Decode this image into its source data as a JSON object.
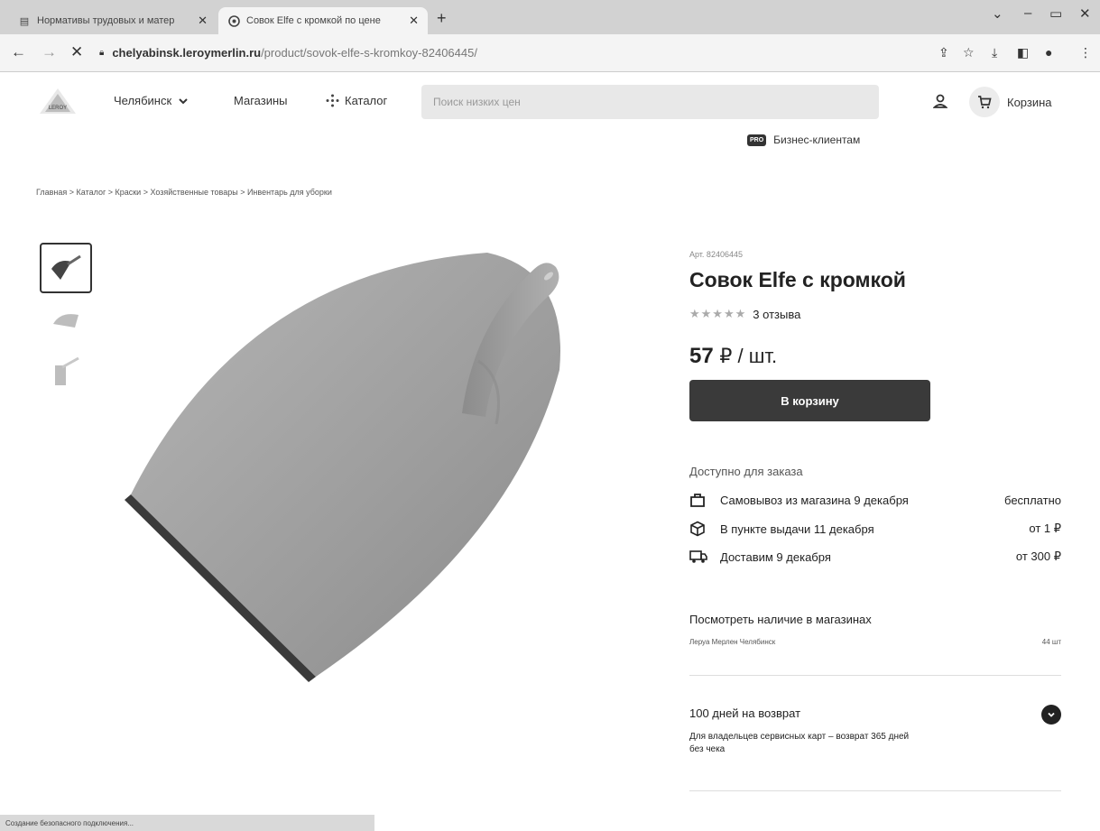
{
  "browser": {
    "tabs": [
      {
        "title": "Нормативы трудовых и матер",
        "active": false
      },
      {
        "title": "Совок Elfe с кромкой по цене",
        "active": true
      }
    ],
    "url_host": "chelyabinsk.leroymerlin.ru",
    "url_path": "/product/sovok-elfe-s-kromkoy-82406445/",
    "status_text": "Создание безопасного подключения..."
  },
  "header": {
    "logo_text": "LEROY MERLIN",
    "city": "Челябинск",
    "stores": "Магазины",
    "catalog": "Каталог",
    "search_placeholder": "Поиск низких цен",
    "cart": "Корзина",
    "business": "Бизнес-клиентам",
    "business_badge": "PRO"
  },
  "breadcrumb": "Главная > Каталог > Краски > Хозяйственные товары > Инвентарь для уборки",
  "product": {
    "article_label": "Арт. 82406445",
    "title": "Совок Elfe с кромкой",
    "rating_value": 0,
    "rating_max": 5,
    "reviews": "3 отзыва",
    "price": "57",
    "price_unit": "₽ / шт.",
    "buy_button": "В корзину",
    "color_main": "#9e9e9e",
    "color_edge": "#3a3a3a"
  },
  "delivery": {
    "heading": "Доступно для заказа",
    "options": [
      {
        "icon": "bag-icon",
        "label": "Самовывоз из магазина 9 декабря",
        "value": "бесплатно"
      },
      {
        "icon": "box-icon",
        "label": "В пункте выдачи 11 декабря",
        "value": "от 1 ₽"
      },
      {
        "icon": "truck-icon",
        "label": "Доставим 9 декабря",
        "value": "от 300 ₽"
      }
    ]
  },
  "stores_availability": {
    "heading": "Посмотреть наличие в магазинах",
    "store_name": "Леруа Мерлен Челябинск",
    "quantity": "44 шт"
  },
  "returns": {
    "heading": "100 дней на возврат",
    "text": "Для владельцев сервисных карт – возврат 365 дней без чека"
  }
}
